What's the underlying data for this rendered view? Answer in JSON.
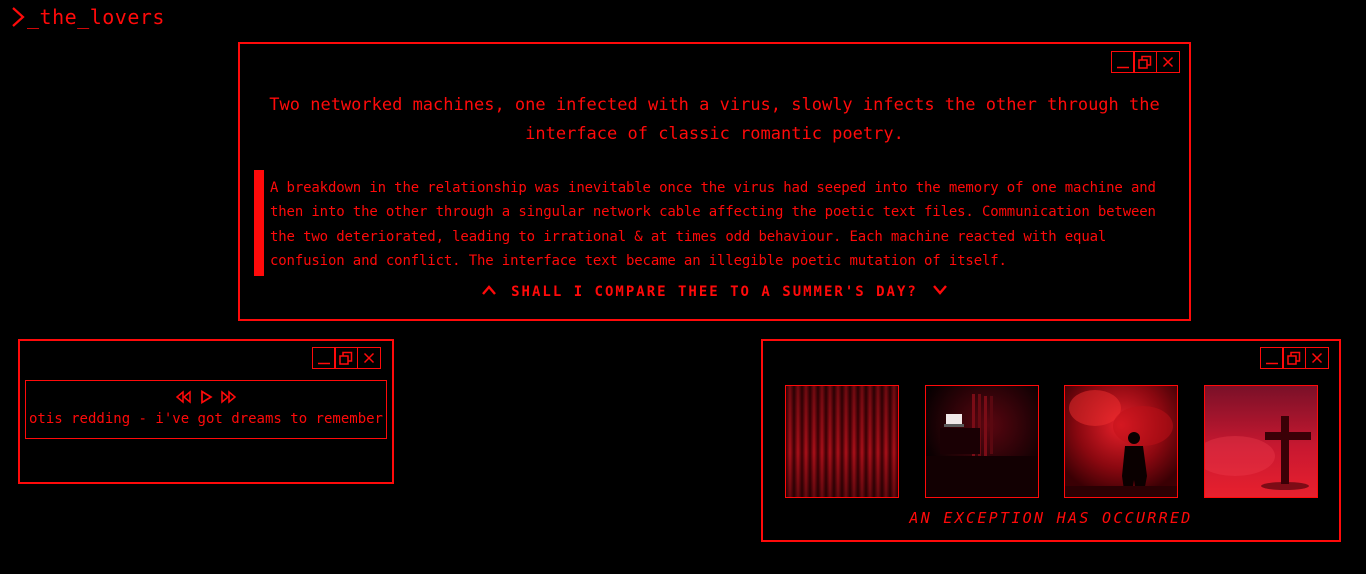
{
  "header": {
    "title": "_the_lovers"
  },
  "main_window": {
    "lead": "Two networked machines, one infected with a virus, slowly infects the other through the interface of classic romantic poetry.",
    "quote": "A breakdown in the relationship was inevitable once the virus had seeped into the memory of one machine and then into the other through a singular network cable affecting the poetic text files. Communication between the two deteriorated, leading to irrational & at times odd behaviour. Each machine reacted with equal confusion and conflict. The interface text became an illegible poetic mutation of itself.",
    "nav_label": "SHALL I COMPARE THEE TO A SUMMER'S DAY?"
  },
  "player_window": {
    "track": "otis redding - i've got dreams to remember"
  },
  "gallery_window": {
    "images": [
      {
        "label": "red-curtain-image"
      },
      {
        "label": "dark-room-laptop-image"
      },
      {
        "label": "silhouette-red-smoke-image"
      },
      {
        "label": "cross-red-light-image"
      }
    ],
    "exception": "AN EXCEPTION HAS OCCURRED"
  },
  "colors": {
    "accent": "#ff0a0a",
    "background": "#000000"
  },
  "icons": [
    "prompt-chevron-icon",
    "minimize-icon",
    "restore-icon",
    "close-icon",
    "chevron-up-icon",
    "chevron-down-icon",
    "rewind-icon",
    "play-icon",
    "fast-forward-icon"
  ]
}
